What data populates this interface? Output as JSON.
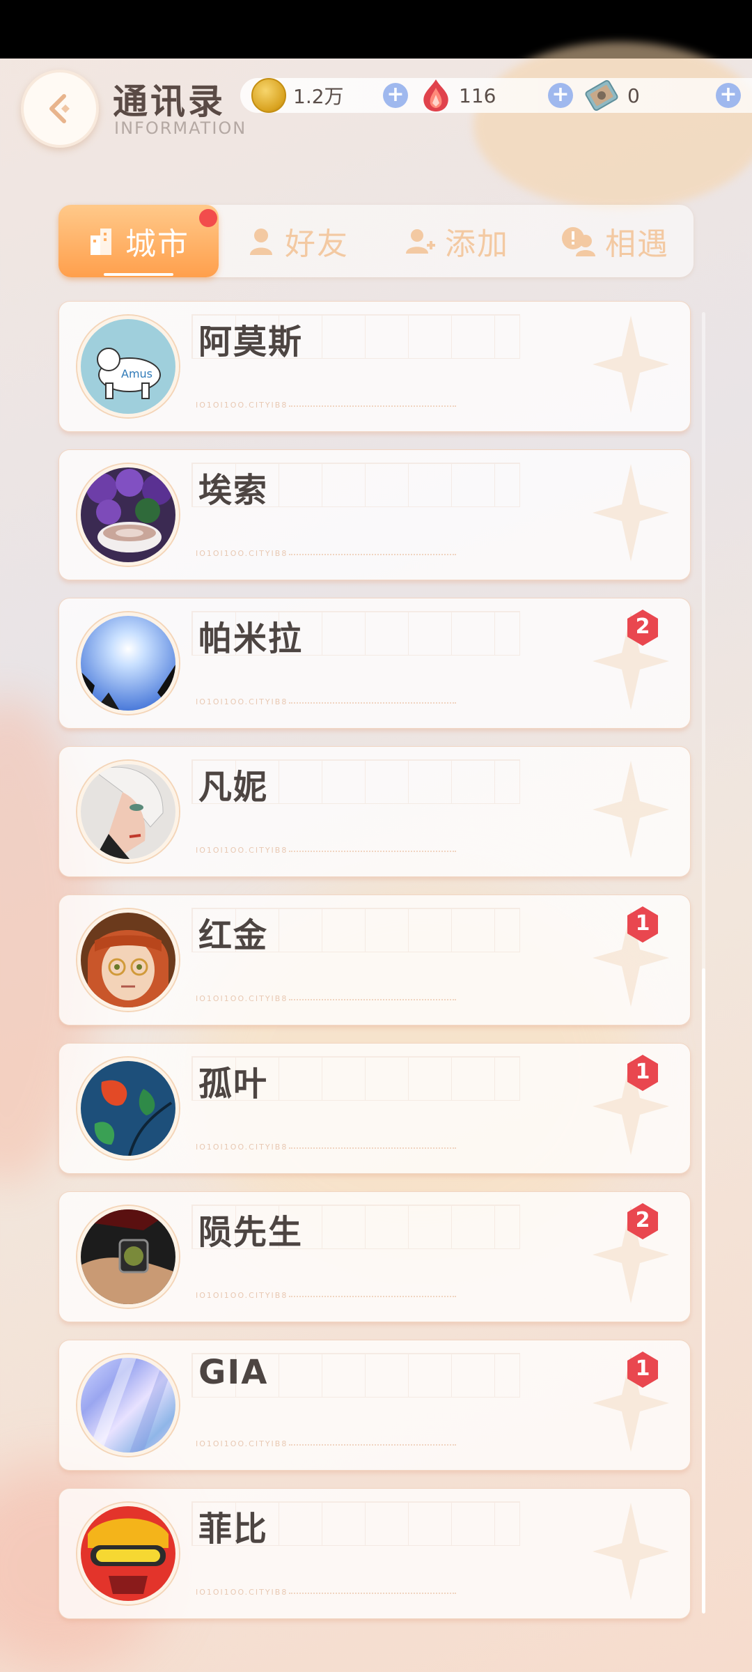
{
  "header": {
    "title": "通讯录",
    "subtitle": "INFORMATION",
    "currency": [
      {
        "icon": "gold-coin-icon",
        "value": "1.2万"
      },
      {
        "icon": "crystal-icon",
        "value": "116"
      },
      {
        "icon": "ticket-icon",
        "value": "0"
      }
    ]
  },
  "tabs": [
    {
      "label": "城市",
      "icon": "city-icon",
      "active": true,
      "has_dot": true
    },
    {
      "label": "好友",
      "icon": "friend-icon",
      "active": false
    },
    {
      "label": "添加",
      "icon": "add-user-icon",
      "active": false
    },
    {
      "label": "相遇",
      "icon": "encounter-icon",
      "active": false
    }
  ],
  "contacts": [
    {
      "name": "阿莫斯",
      "avatar": "polar-bear-avatar",
      "avatar_text": "Amus",
      "badge": null,
      "serial": "IO1OI1OO.CITYIB8"
    },
    {
      "name": "埃索",
      "avatar": "coffee-flowers-avatar",
      "badge": null,
      "serial": "IO1OI1OO.CITYIB8"
    },
    {
      "name": "帕米拉",
      "avatar": "sky-sun-avatar",
      "badge": "2",
      "serial": "IO1OI1OO.CITYIB8"
    },
    {
      "name": "凡妮",
      "avatar": "white-hair-girl-avatar",
      "badge": null,
      "serial": "IO1OI1OO.CITYIB8"
    },
    {
      "name": "红金",
      "avatar": "glasses-girl-avatar",
      "badge": "1",
      "serial": "IO1OI1OO.CITYIB8"
    },
    {
      "name": "孤叶",
      "avatar": "leaves-avatar",
      "badge": "1",
      "serial": "IO1OI1OO.CITYIB8"
    },
    {
      "name": "陨先生",
      "avatar": "wristwatch-avatar",
      "badge": "2",
      "serial": "IO1OI1OO.CITYIB8"
    },
    {
      "name": "GIA",
      "avatar": "holographic-avatar",
      "badge": "1",
      "serial": "IO1OI1OO.CITYIB8"
    },
    {
      "name": "菲比",
      "avatar": "goggles-character-avatar",
      "badge": null,
      "serial": "IO1OI1OO.CITYIB8"
    }
  ],
  "colors": {
    "accent": "#ff9f4c",
    "badge": "#e9474f",
    "tab_inactive": "#f3c9a2"
  }
}
